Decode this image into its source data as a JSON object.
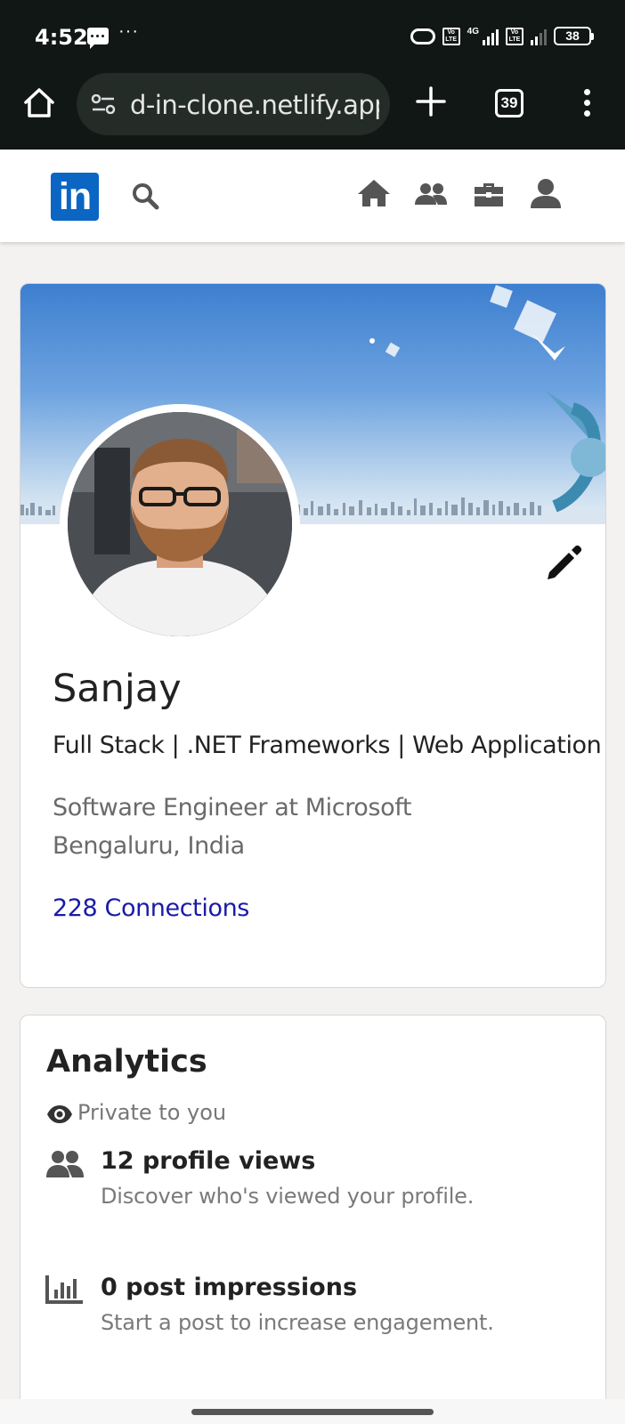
{
  "status_bar": {
    "time": "4:52",
    "more": "···",
    "network": "4G",
    "volte_label": "Vo LTE",
    "battery": "38"
  },
  "browser": {
    "url": "d-in-clone.netlify.app",
    "tab_count": "39"
  },
  "header": {
    "logo_text": "in",
    "nav_icons": [
      "home-icon",
      "people-icon",
      "jobs-icon",
      "profile-icon"
    ]
  },
  "profile": {
    "name": "Sanjay",
    "headline": "Full Stack | .NET Frameworks | Web Application",
    "job": "Software Engineer at Microsoft",
    "location": "Bengaluru, India",
    "connections": "228 Connections"
  },
  "analytics": {
    "title": "Analytics",
    "visibility": "Private to you",
    "stats": [
      {
        "icon": "people-icon",
        "title": "12 profile views",
        "description": "Discover who's viewed your profile."
      },
      {
        "icon": "bar-chart-icon",
        "title": "0 post impressions",
        "description": "Start a post to increase engagement."
      }
    ]
  },
  "colors": {
    "brand": "#0a66c2",
    "link": "#1a1aa8",
    "status_bar_bg": "#111714"
  }
}
